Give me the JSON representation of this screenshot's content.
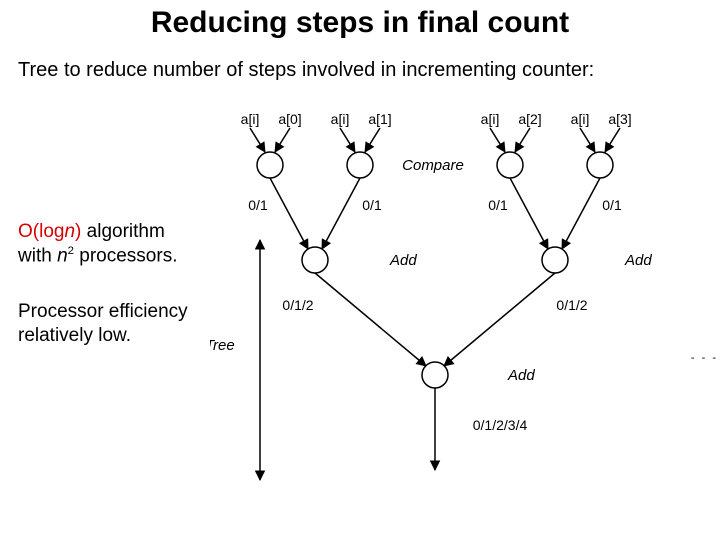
{
  "title": "Reducing steps in final count",
  "subtitle": "Tree to reduce number of steps involved in incrementing counter:",
  "side": {
    "l1a": "O(log",
    "l1b": "n",
    "l1c": ")",
    "l1d": " algorithm",
    "l2a": "with ",
    "l2b": "n",
    "l2c": " processors.",
    "eff1": "Processor efficiency",
    "eff2": "relatively low."
  },
  "labels": {
    "top": [
      "a[i]",
      "a[0]",
      "a[i]",
      "a[1]",
      "a[i]",
      "a[2]",
      "a[i]",
      "a[3]"
    ],
    "compare": "Compare",
    "add": "Add",
    "tree": "Tree",
    "l1": "0/1",
    "l2": "0/1/2",
    "l3": "0/1/2/3/4"
  },
  "page": "- - -"
}
